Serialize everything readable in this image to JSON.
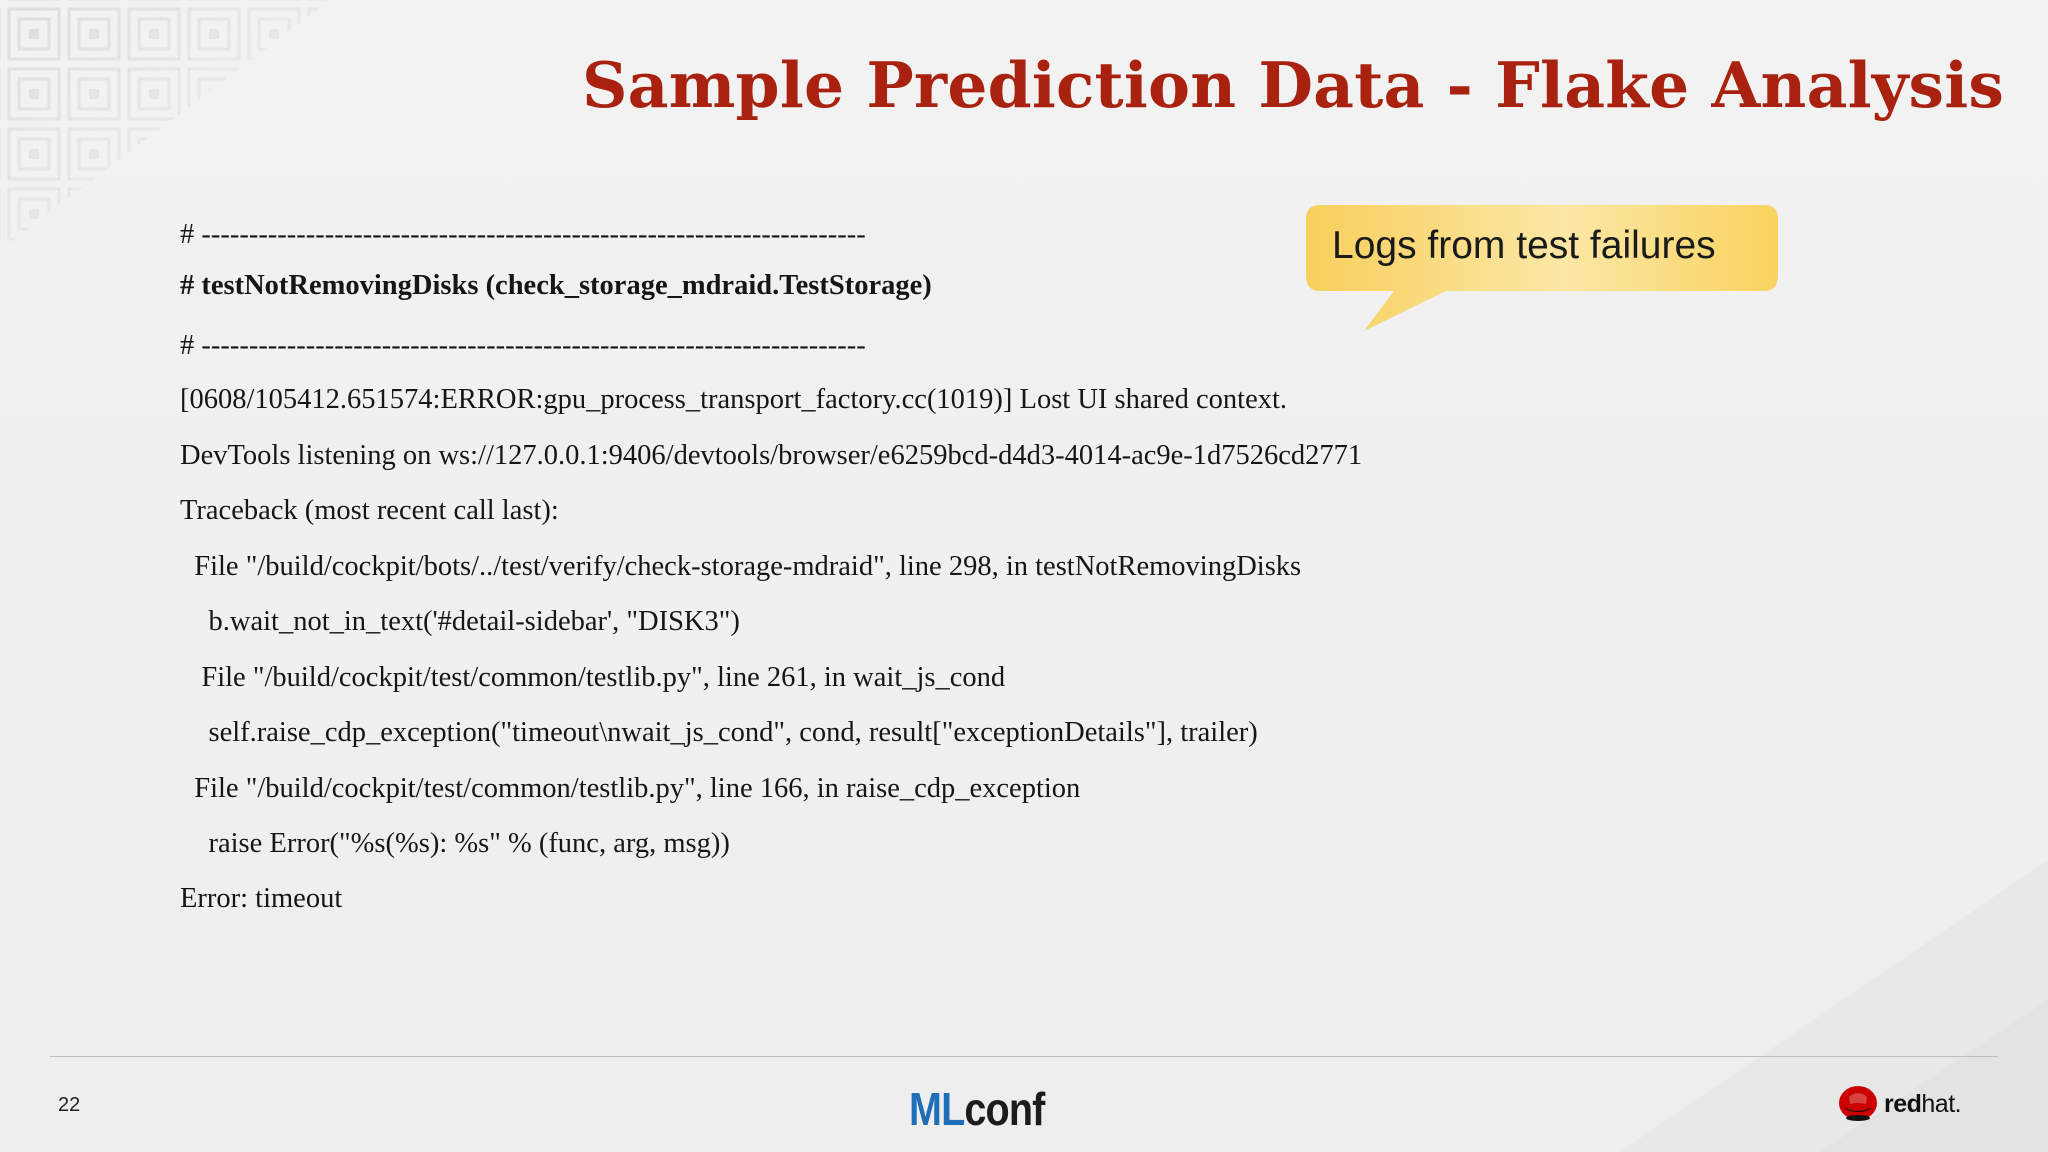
{
  "slide": {
    "title": "Sample Prediction Data - Flake Analysis",
    "callout": "Logs from test failures",
    "log_lines": [
      "# ----------------------------------------------------------------------",
      "# testNotRemovingDisks (check_storage_mdraid.TestStorage)",
      "# ----------------------------------------------------------------------",
      "[0608/105412.651574:ERROR:gpu_process_transport_factory.cc(1019)] Lost UI shared context.",
      "DevTools listening on ws://127.0.0.1:9406/devtools/browser/e6259bcd-d4d3-4014-ac9e-1d7526cd2771",
      "Traceback (most recent call last):",
      "  File \"/build/cockpit/bots/../test/verify/check-storage-mdraid\", line 298, in testNotRemovingDisks",
      "    b.wait_not_in_text('#detail-sidebar', \"DISK3\")",
      "   File \"/build/cockpit/test/common/testlib.py\", line 261, in wait_js_cond",
      "    self.raise_cdp_exception(\"timeout\\nwait_js_cond\", cond, result[\"exceptionDetails\"], trailer)",
      "  File \"/build/cockpit/test/common/testlib.py\", line 166, in raise_cdp_exception",
      "    raise Error(\"%s(%s): %s\" % (func, arg, msg))",
      "Error: timeout"
    ]
  },
  "footer": {
    "page_number": "22",
    "mlconf_ml": "ML",
    "mlconf_conf": "conf",
    "redhat_bold": "red",
    "redhat_light": "hat."
  },
  "colors": {
    "title": "#a8220f",
    "callout_fill": "#f9d56a",
    "mlconf_blue": "#1e6fb8",
    "redhat_red": "#cc0000"
  },
  "icons": [
    "corner-pattern",
    "redhat-shadowman-icon"
  ]
}
